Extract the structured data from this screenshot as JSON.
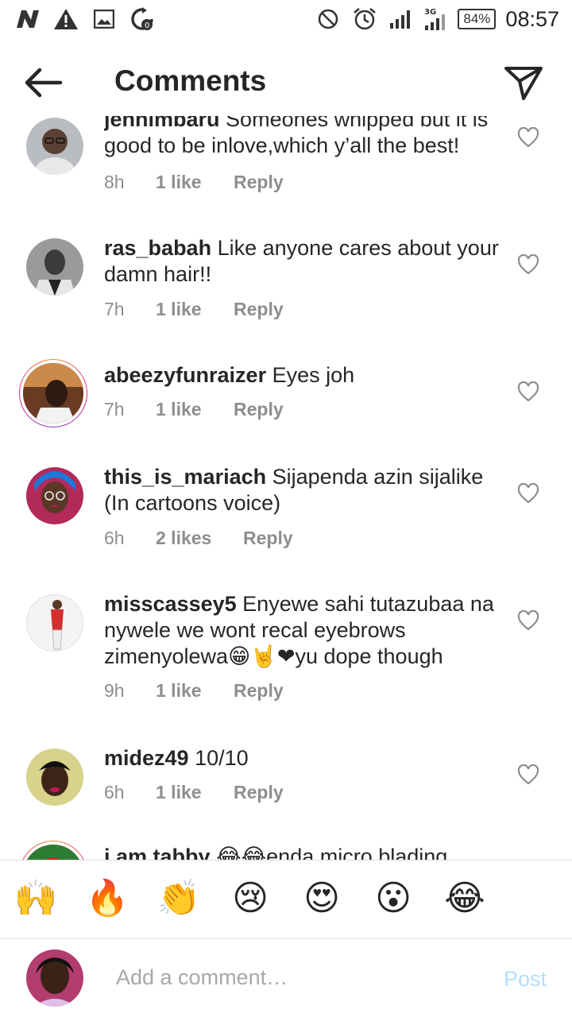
{
  "status_bar": {
    "battery": "84%",
    "time": "08:57",
    "network": "3G"
  },
  "header": {
    "title": "Comments"
  },
  "comments": [
    {
      "username": "jennimbaru",
      "text": "Someones whipped but it is good to be inlove,which y’all the best!",
      "line2": "good to be inlove,which y’all the best!",
      "time": "8h",
      "likes": "1 like",
      "reply": "Reply"
    },
    {
      "username": "ras_babah",
      "text": "Like anyone cares about your damn hair!!",
      "time": "7h",
      "likes": "1 like",
      "reply": "Reply"
    },
    {
      "username": "abeezyfunraizer",
      "text": "Eyes joh",
      "time": "7h",
      "likes": "1 like",
      "reply": "Reply"
    },
    {
      "username": "this_is_mariach",
      "text": "Sijapenda azin sijalike (In cartoons voice)",
      "time": "6h",
      "likes": "2 likes",
      "reply": "Reply"
    },
    {
      "username": "misscassey5",
      "text": "Enyewe sahi tutazubaa na nywele we wont recal eyebrows zimenyolewa😁🤘❤yu dope though",
      "time": "9h",
      "likes": "1 like",
      "reply": "Reply"
    },
    {
      "username": "midez49",
      "text": "10/10",
      "time": "6h",
      "likes": "1 like",
      "reply": "Reply"
    },
    {
      "username": "i.am.tabby",
      "text": "😂😂enda micro blading"
    }
  ],
  "emoji_bar": [
    "🙌",
    "🔥",
    "👏",
    "😢",
    "😍",
    "😮",
    "😂"
  ],
  "composer": {
    "placeholder": "Add a comment…",
    "post_label": "Post"
  },
  "colors": {
    "text": "#262626",
    "meta": "#8e8e8e",
    "post_disabled": "#b2dffc",
    "story_ring": "#dd2a7b"
  }
}
